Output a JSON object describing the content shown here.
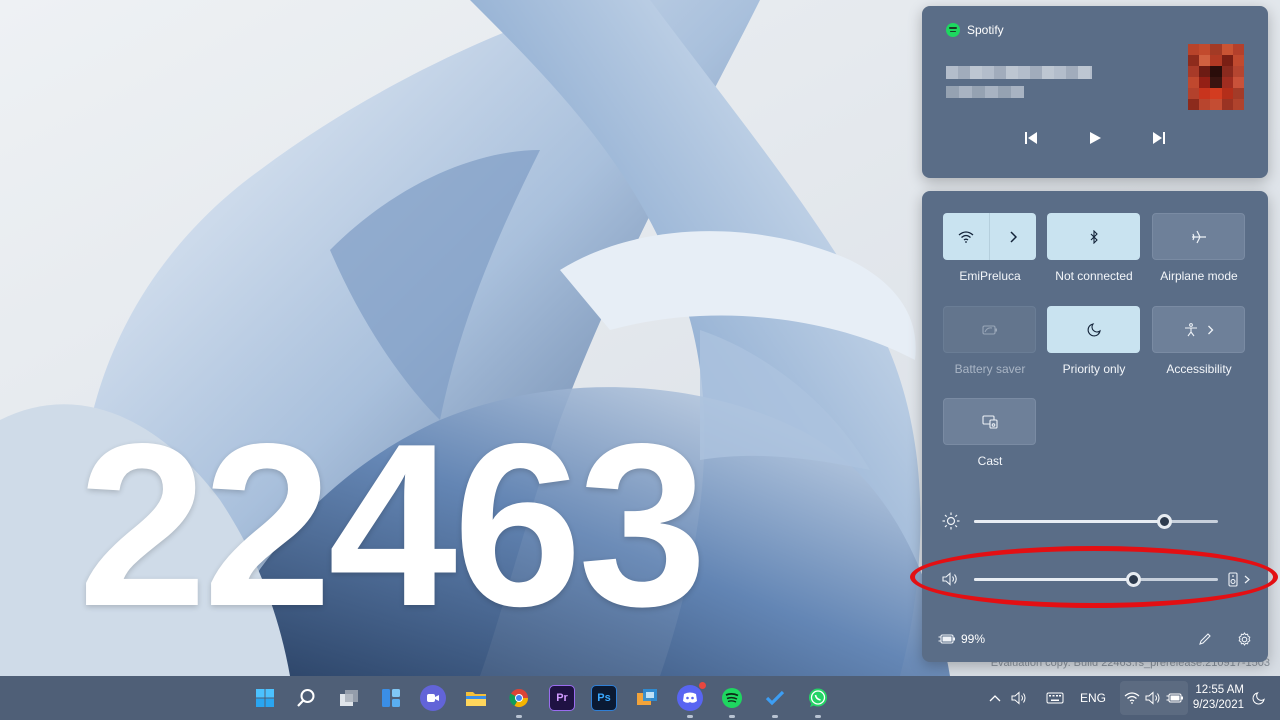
{
  "wallpaper": {
    "overlay_text": "22463",
    "watermark": "Evaluation copy. Build 22463.rs_prerelease.210917-1503"
  },
  "media": {
    "app_name": "Spotify",
    "album_colors": [
      "#b8432a",
      "#c24a2d",
      "#a33a25",
      "#c95434",
      "#b4402b",
      "#8e2b1c",
      "#d06040",
      "#b13a24",
      "#7a1f14",
      "#c14a2f",
      "#a83a28",
      "#6d1b13",
      "#2a0d0a",
      "#8a2a1e",
      "#b54530",
      "#c0482e",
      "#941f15",
      "#3a1410",
      "#a02d20",
      "#c9523a",
      "#b3412c",
      "#c8341d",
      "#d33c20",
      "#b42e1a",
      "#a33b28",
      "#8c2a1c",
      "#b8452e",
      "#c44d33",
      "#9a3323",
      "#b0432d"
    ],
    "icons": {
      "previous": "previous-track-icon",
      "play": "play-icon",
      "next": "next-track-icon"
    }
  },
  "quick_settings": {
    "tiles": [
      {
        "id": "wifi",
        "label": "EmiPreluca",
        "state": "on",
        "icon": "wifi-icon"
      },
      {
        "id": "bluetooth",
        "label": "Not connected",
        "state": "on",
        "icon": "bluetooth-icon"
      },
      {
        "id": "airplane",
        "label": "Airplane mode",
        "state": "off",
        "icon": "airplane-icon"
      },
      {
        "id": "battery-saver",
        "label": "Battery saver",
        "state": "disabled",
        "icon": "battery-saver-icon"
      },
      {
        "id": "focus-assist",
        "label": "Priority only",
        "state": "on",
        "icon": "moon-icon"
      },
      {
        "id": "accessibility",
        "label": "Accessibility",
        "state": "off",
        "icon": "accessibility-icon"
      },
      {
        "id": "cast",
        "label": "Cast",
        "state": "off",
        "icon": "cast-icon"
      }
    ],
    "brightness": {
      "value": 0.78,
      "icon": "brightness-icon"
    },
    "volume": {
      "value": 0.65,
      "icon": "speaker-icon",
      "output_icon": "speaker-device-icon"
    },
    "battery_percent": "99%",
    "highlight_color": "#e30f13"
  },
  "taskbar": {
    "apps": [
      "start",
      "search",
      "task-view",
      "widgets",
      "teams-chat",
      "file-explorer",
      "chrome",
      "premiere",
      "photoshop",
      "edge-like",
      "discord",
      "spotify",
      "todo",
      "whatsapp"
    ],
    "app_labels": {
      "premiere": "Pr",
      "photoshop": "Ps"
    },
    "language": "ENG",
    "time": "12:55 AM",
    "date": "9/23/2021"
  }
}
